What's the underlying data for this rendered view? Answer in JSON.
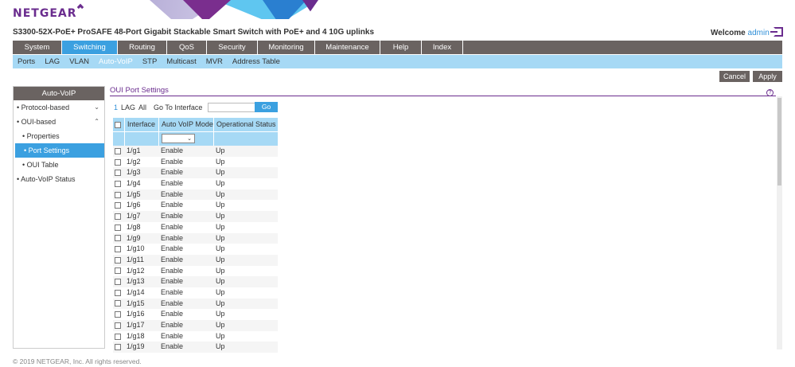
{
  "brand": "NETGEAR",
  "product_title": "S3300-52X-PoE+ ProSAFE 48-Port Gigabit Stackable Smart Switch with PoE+ and 4 10G uplinks",
  "welcome": {
    "label": "Welcome",
    "user": "admin"
  },
  "main_nav": [
    {
      "label": "System",
      "w": 62,
      "active": false
    },
    {
      "label": "Switching",
      "w": 70,
      "active": true
    },
    {
      "label": "Routing",
      "w": 62,
      "active": false
    },
    {
      "label": "QoS",
      "w": 50,
      "active": false
    },
    {
      "label": "Security",
      "w": 64,
      "active": false
    },
    {
      "label": "Monitoring",
      "w": 72,
      "active": false
    },
    {
      "label": "Maintenance",
      "w": 82,
      "active": false
    },
    {
      "label": "Help",
      "w": 52,
      "active": false
    },
    {
      "label": "Index",
      "w": 52,
      "active": false
    }
  ],
  "sub_nav": [
    {
      "label": "Ports",
      "active": false
    },
    {
      "label": "LAG",
      "active": false
    },
    {
      "label": "VLAN",
      "active": false
    },
    {
      "label": "Auto-VoIP",
      "active": true
    },
    {
      "label": "STP",
      "active": false
    },
    {
      "label": "Multicast",
      "active": false
    },
    {
      "label": "MVR",
      "active": false
    },
    {
      "label": "Address Table",
      "active": false
    }
  ],
  "buttons": {
    "cancel": "Cancel",
    "apply": "Apply"
  },
  "sidebar": {
    "title": "Auto-VoIP",
    "items": [
      {
        "label": "• Protocol-based",
        "sub": false,
        "active": false,
        "chev": "⌄"
      },
      {
        "label": "• OUI-based",
        "sub": false,
        "active": false,
        "chev": "⌃"
      },
      {
        "label": "• Properties",
        "sub": true,
        "active": false,
        "chev": ""
      },
      {
        "label": "• Port Settings",
        "sub": true,
        "active": true,
        "chev": ""
      },
      {
        "label": "• OUI Table",
        "sub": true,
        "active": false,
        "chev": ""
      },
      {
        "label": "• Auto-VoIP Status",
        "sub": false,
        "active": false,
        "chev": ""
      }
    ]
  },
  "panel": {
    "title": "OUI Port Settings",
    "toolbar": {
      "unit": "1",
      "lag": "LAG",
      "all": "All",
      "goto_label": "Go To Interface",
      "goto_value": "",
      "go": "Go"
    },
    "columns": [
      "Interface",
      "Auto VoIP Mode",
      "Operational Status"
    ],
    "rows": [
      {
        "interface": "1/g1",
        "mode": "Enable",
        "status": "Up"
      },
      {
        "interface": "1/g2",
        "mode": "Enable",
        "status": "Up"
      },
      {
        "interface": "1/g3",
        "mode": "Enable",
        "status": "Up"
      },
      {
        "interface": "1/g4",
        "mode": "Enable",
        "status": "Up"
      },
      {
        "interface": "1/g5",
        "mode": "Enable",
        "status": "Up"
      },
      {
        "interface": "1/g6",
        "mode": "Enable",
        "status": "Up"
      },
      {
        "interface": "1/g7",
        "mode": "Enable",
        "status": "Up"
      },
      {
        "interface": "1/g8",
        "mode": "Enable",
        "status": "Up"
      },
      {
        "interface": "1/g9",
        "mode": "Enable",
        "status": "Up"
      },
      {
        "interface": "1/g10",
        "mode": "Enable",
        "status": "Up"
      },
      {
        "interface": "1/g11",
        "mode": "Enable",
        "status": "Up"
      },
      {
        "interface": "1/g12",
        "mode": "Enable",
        "status": "Up"
      },
      {
        "interface": "1/g13",
        "mode": "Enable",
        "status": "Up"
      },
      {
        "interface": "1/g14",
        "mode": "Enable",
        "status": "Up"
      },
      {
        "interface": "1/g15",
        "mode": "Enable",
        "status": "Up"
      },
      {
        "interface": "1/g16",
        "mode": "Enable",
        "status": "Up"
      },
      {
        "interface": "1/g17",
        "mode": "Enable",
        "status": "Up"
      },
      {
        "interface": "1/g18",
        "mode": "Enable",
        "status": "Up"
      },
      {
        "interface": "1/g19",
        "mode": "Enable",
        "status": "Up"
      }
    ]
  },
  "footer": "© 2019 NETGEAR, Inc. All rights reserved.",
  "icons": {
    "help": "help-icon",
    "logout": "logout-icon",
    "dropdown": "chevron-down-icon"
  },
  "colors": {
    "brand": "#6a2c8e",
    "accent": "#3ba0e0",
    "subnav": "#a6d9f5",
    "nav": "#6a6361"
  }
}
